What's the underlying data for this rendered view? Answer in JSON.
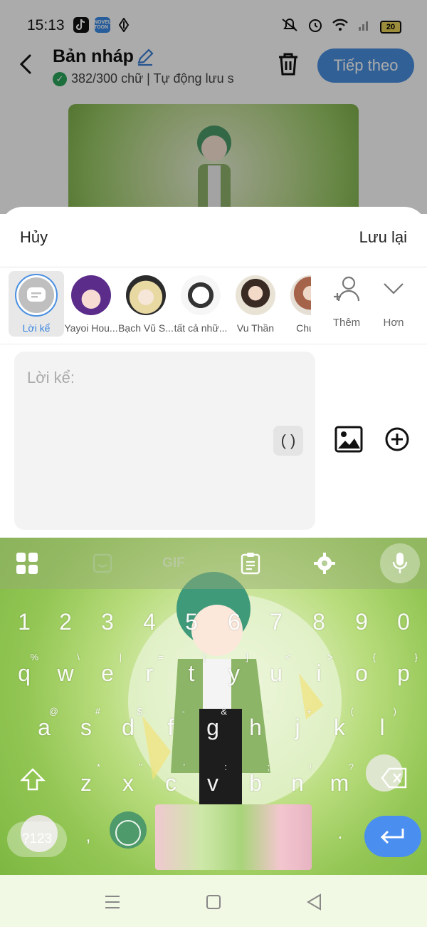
{
  "status_bar": {
    "time": "15:13",
    "app_icons": [
      "tiktok-icon",
      "novel-toon-icon",
      "diamond-icon"
    ],
    "novel_toon_text": "NOVEL TOON",
    "battery": "20"
  },
  "header": {
    "title": "Bản nháp",
    "subtitle": "382/300 chữ | Tự động lưu s",
    "next_label": "Tiếp theo"
  },
  "sheet": {
    "cancel_label": "Hủy",
    "save_label": "Lưu lại",
    "characters": [
      {
        "name": "Lời kể",
        "selected": true
      },
      {
        "name": "Yayoi Hou...",
        "selected": false
      },
      {
        "name": "Bạch Vũ S...",
        "selected": false
      },
      {
        "name": "tất cả nhữ...",
        "selected": false
      },
      {
        "name": "Vu Thần",
        "selected": false
      },
      {
        "name": "Chu Đ",
        "selected": false
      }
    ],
    "add_label": "Thêm",
    "more_label": "Hơn",
    "input_placeholder": "Lời kể:",
    "paren_label": "( )"
  },
  "keyboard": {
    "toolbar": [
      "apps-icon",
      "sticker-icon",
      "gif-icon",
      "clipboard-icon",
      "gear-icon",
      "mic-icon"
    ],
    "gif_label": "GIF",
    "numbers": [
      "1",
      "2",
      "3",
      "4",
      "5",
      "6",
      "7",
      "8",
      "9",
      "0"
    ],
    "row1": [
      "q",
      "w",
      "e",
      "r",
      "t",
      "y",
      "u",
      "i",
      "o",
      "p"
    ],
    "row1_hints": [
      "%",
      "\\",
      "|",
      "=",
      "[",
      "]",
      "<",
      ">",
      "{",
      "}"
    ],
    "row2": [
      "a",
      "s",
      "d",
      "f",
      "g",
      "h",
      "j",
      "k",
      "l"
    ],
    "row2_hints": [
      "@",
      "#",
      "$",
      "-",
      "&",
      "-",
      "+",
      "(",
      ")"
    ],
    "row3": [
      "z",
      "x",
      "c",
      "v",
      "b",
      "n",
      "m"
    ],
    "row3_hints": [
      "*",
      "\"",
      "'",
      ":",
      ";",
      "!",
      "?"
    ],
    "key_123": "?123",
    "comma": ",",
    "period": "."
  },
  "colors": {
    "accent": "#4a90e2",
    "check": "#2aa55b",
    "keyboard_green": "#93c654",
    "enter": "#4a8ff0"
  }
}
